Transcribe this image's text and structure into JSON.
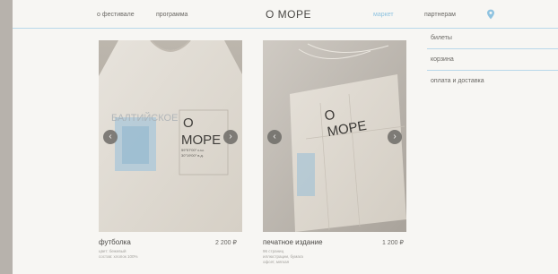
{
  "header": {
    "nav_left": [
      "о фестивале",
      "программа"
    ],
    "logo": "О МОРЕ",
    "nav_right": [
      {
        "label": "маркет",
        "active": true
      },
      {
        "label": "партнерам",
        "active": false
      }
    ],
    "pin_icon": "map-pin-icon",
    "accent_color": "#8fc3e0"
  },
  "sidebar": {
    "items": [
      "билеты",
      "корзина",
      "оплата и доставка"
    ]
  },
  "products": [
    {
      "name": "футболка",
      "price": "2 200 ₽",
      "desc_line1": "цвет: бежевый",
      "desc_line2": "состав: хлопок 100%",
      "print_title": "О",
      "print_title2": "МОРЕ",
      "print_small": "БАЛТИЙСКОЕ",
      "print_coords": "59°57′00″ с.ш.",
      "print_coords2": "30°19′00″ в.д."
    },
    {
      "name": "печатное издание",
      "price": "1 200 ₽",
      "desc_line1": "96 страниц",
      "desc_line2": "иллюстрации, бумага",
      "desc_line3": "офсет, мягкая",
      "print_title": "О",
      "print_title2": "МОРЕ"
    }
  ],
  "icons": {
    "prev": "chevron-left-icon",
    "next": "chevron-right-icon"
  }
}
